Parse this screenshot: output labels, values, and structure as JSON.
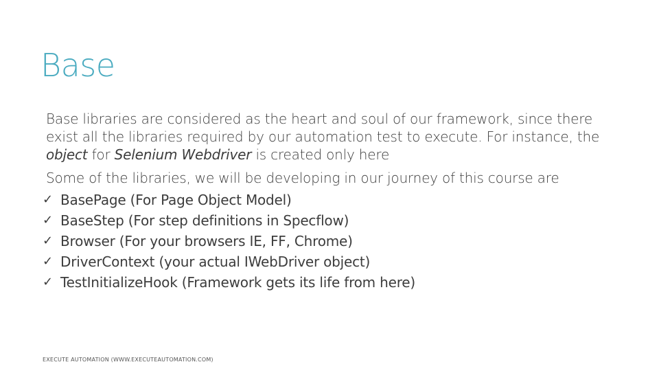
{
  "slide": {
    "title": "Base",
    "paragraph1": {
      "part1": "Base libraries are considered as the heart and soul of our framework, since there exist all the libraries required by our automation test to execute. For instance, the ",
      "italic1": "object",
      "part2": " for ",
      "italic2": "Selenium Webdriver",
      "part3": " is created only here"
    },
    "paragraph2": "Some of the libraries, we will be developing in our journey of this course are",
    "check_icon": "check-icon",
    "bullets": [
      "BasePage (For Page Object Model)",
      "BaseStep (For step definitions in Specflow)",
      "Browser (For your browsers IE, FF, Chrome)",
      "DriverContext (your actual IWebDriver object)",
      "TestInitializeHook (Framework gets its life from here)"
    ],
    "footer": "EXECUTE AUTOMATION (WWW.EXECUTEAUTOMATION.COM)"
  }
}
